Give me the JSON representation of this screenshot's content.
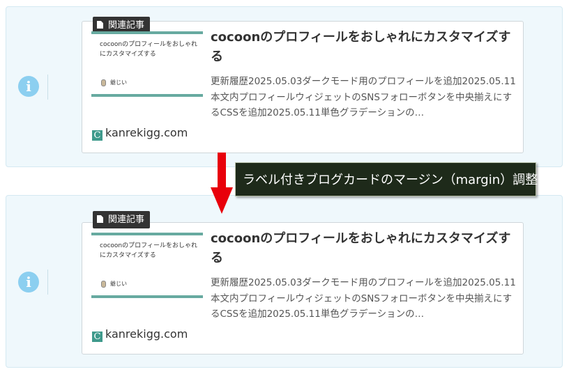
{
  "blog_card": {
    "label": "関連記事",
    "title": "cocoonのプロフィールをおしゃれにカスタマイズする",
    "snippet": "更新履歴2025.05.03ダークモード用のプロフィールを追加2025.05.11本文内プロフィールウィジェットのSNSフォローボタンを中央揃えにするCSSを追加2025.05.11単色グラデーションの…",
    "thumb_text": "cocoonのプロフィールをおしゃれにカスタマイズする",
    "thumb_author": "爺じい",
    "site": "kanrekigg.com",
    "favicon": "C"
  },
  "annotation": {
    "text": "ラベル付きブログカードのマージン（margin）調整"
  },
  "icons": {
    "info": "i",
    "arrow_color": "#e8000b"
  }
}
